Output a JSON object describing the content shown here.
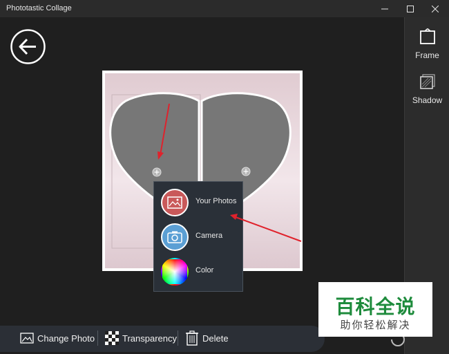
{
  "window": {
    "title": "Phototastic Collage",
    "controls": [
      "minimize",
      "maximize",
      "close"
    ]
  },
  "right_panel": {
    "items": [
      {
        "label": "Frame",
        "icon": "frame-icon"
      },
      {
        "label": "Shadow",
        "icon": "shadow-icon"
      }
    ]
  },
  "popup": {
    "items": [
      {
        "label": "Your Photos",
        "icon": "photos-icon",
        "color": "#c9595a"
      },
      {
        "label": "Camera",
        "icon": "camera-icon",
        "color": "#5b9fd4"
      },
      {
        "label": "Color",
        "icon": "color-wheel-icon",
        "color": "rainbow"
      }
    ]
  },
  "bottom_bar": {
    "change_photo": "Change Photo",
    "transparency": "Transparency",
    "delete": "Delete"
  },
  "watermark": {
    "main": "百科全说",
    "sub": "助你轻松解决"
  },
  "colors": {
    "background": "#1f1f1f",
    "panel": "#2c2c2c",
    "popup": "#2a3038",
    "annotation_arrow": "#e0222c",
    "watermark_green": "#1e8b3c"
  }
}
